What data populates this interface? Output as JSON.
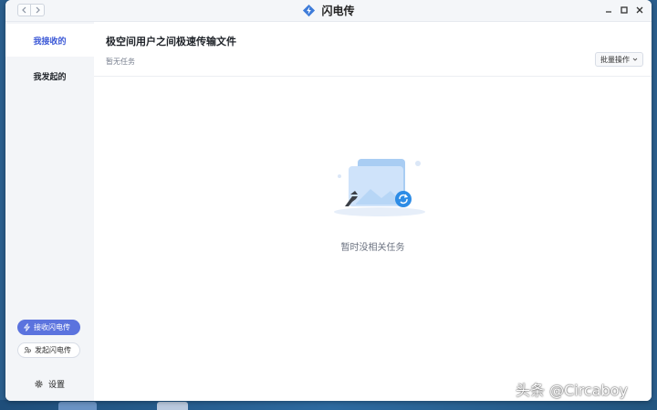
{
  "window": {
    "title": "闪电传"
  },
  "sidebar": {
    "items": [
      {
        "label": "我接收的",
        "active": true
      },
      {
        "label": "我发起的",
        "active": false
      }
    ],
    "receive_button": "接收闪电传",
    "send_button": "发起闪电传",
    "settings_label": "设置"
  },
  "main": {
    "title": "极空间用户之间极速传输文件",
    "status": "暂无任务",
    "batch_button": "批量操作",
    "empty_text": "暂时没相关任务"
  },
  "watermark": "头条 @Circaboy",
  "colors": {
    "accent": "#3a57d6",
    "primary_button": "#5b73de",
    "sidebar_bg": "#f3f5f8"
  },
  "icons": {
    "app": "lightning-bolt-icon",
    "back": "chevron-left-icon",
    "forward": "chevron-right-icon",
    "minimize": "minimize-icon",
    "maximize": "maximize-icon",
    "close": "close-icon",
    "receive": "lightning-icon",
    "send": "people-icon",
    "settings": "gear-icon",
    "batch": "chevron-down-icon"
  }
}
